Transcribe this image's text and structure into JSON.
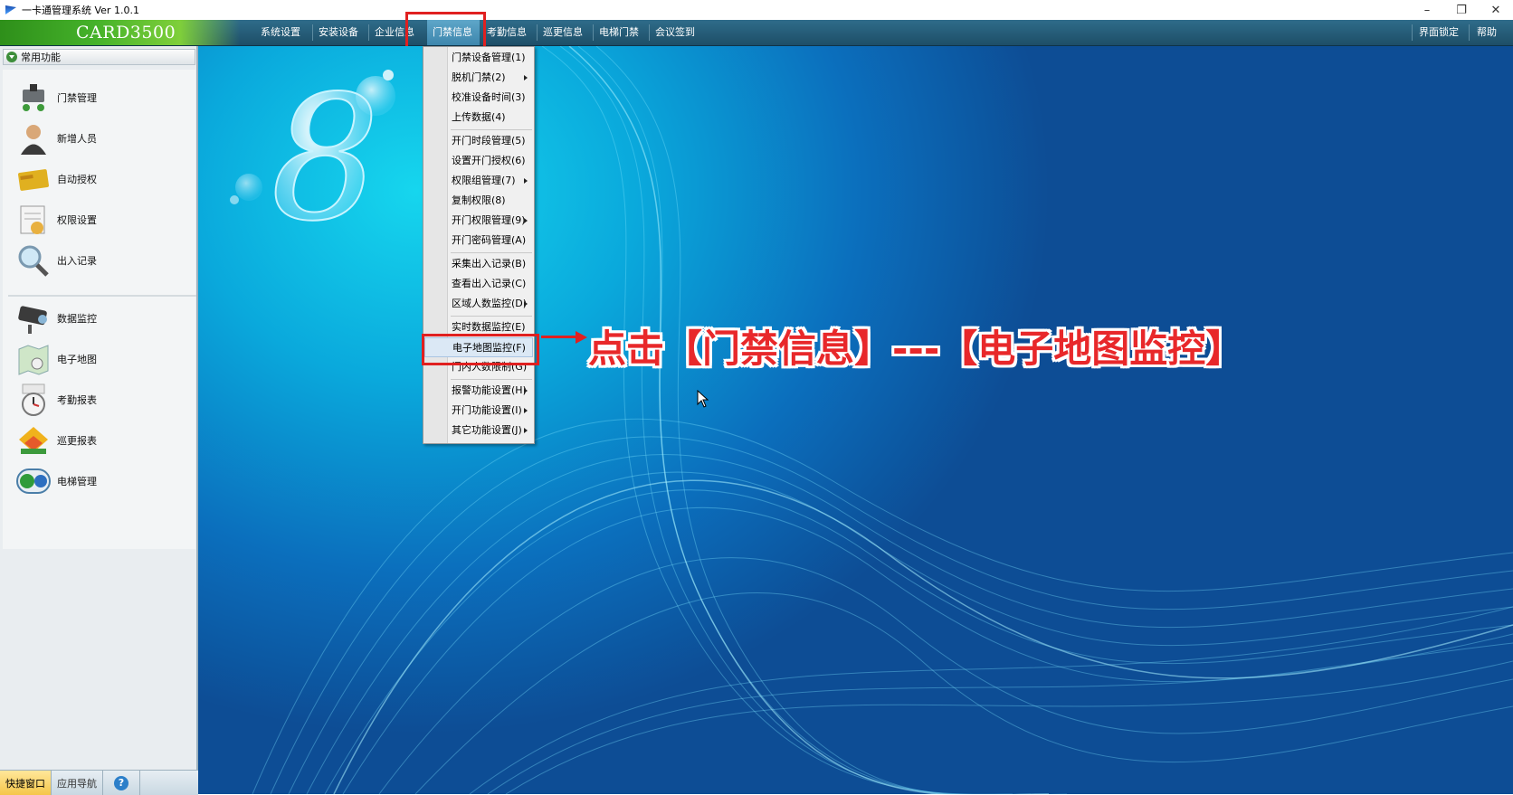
{
  "window": {
    "title": "一卡通管理系统  Ver 1.0.1",
    "controls": [
      "–",
      "❐",
      "✕"
    ]
  },
  "menubar": {
    "logo": "CARD3500",
    "items": [
      "系统设置",
      "安装设备",
      "企业信息",
      "门禁信息",
      "考勤信息",
      "巡更信息",
      "电梯门禁",
      "会议签到"
    ],
    "active_item": "门禁信息",
    "right_items": [
      "界面锁定",
      "帮助"
    ]
  },
  "sidebar": {
    "header": "常用功能",
    "group1": [
      "门禁管理",
      "新增人员",
      "自动授权",
      "权限设置",
      "出入记录"
    ],
    "group2": [
      "数据监控",
      "电子地图",
      "考勤报表",
      "巡更报表",
      "电梯管理"
    ],
    "bottom_tabs": [
      "快捷窗口",
      "应用导航",
      "?"
    ]
  },
  "dropdown": {
    "items": [
      {
        "label": "门禁设备管理(1)",
        "submenu": false
      },
      {
        "label": "脱机门禁(2)",
        "submenu": true
      },
      {
        "label": "校准设备时间(3)",
        "submenu": false
      },
      {
        "label": "上传数据(4)",
        "submenu": false
      },
      {
        "label": "开门时段管理(5)",
        "submenu": false
      },
      {
        "label": "设置开门授权(6)",
        "submenu": false
      },
      {
        "label": "权限组管理(7)",
        "submenu": true
      },
      {
        "label": "复制权限(8)",
        "submenu": false
      },
      {
        "label": "开门权限管理(9)",
        "submenu": true
      },
      {
        "label": "开门密码管理(A)",
        "submenu": false
      },
      {
        "label": "采集出入记录(B)",
        "submenu": false
      },
      {
        "label": "查看出入记录(C)",
        "submenu": false
      },
      {
        "label": "区域人数监控(D)",
        "submenu": true
      },
      {
        "label": "实时数据监控(E)",
        "submenu": false
      },
      {
        "label": "电子地图监控(F)",
        "submenu": false
      },
      {
        "label": "门内人数限制(G)",
        "submenu": false
      },
      {
        "label": "报警功能设置(H)",
        "submenu": true
      },
      {
        "label": "开门功能设置(I)",
        "submenu": true
      },
      {
        "label": "其它功能设置(J)",
        "submenu": true
      }
    ],
    "highlighted": "电子地图监控(F)"
  },
  "annotation": {
    "text": "点击【门禁信息】---【电子地图监控】",
    "color": "#e8282a"
  },
  "colors": {
    "menubar": "#245a75",
    "logo_green": "#45b22a",
    "highlight_red": "#e02020",
    "desktop_cyan": "#16d6ee",
    "desktop_blue": "#0d4d95"
  }
}
